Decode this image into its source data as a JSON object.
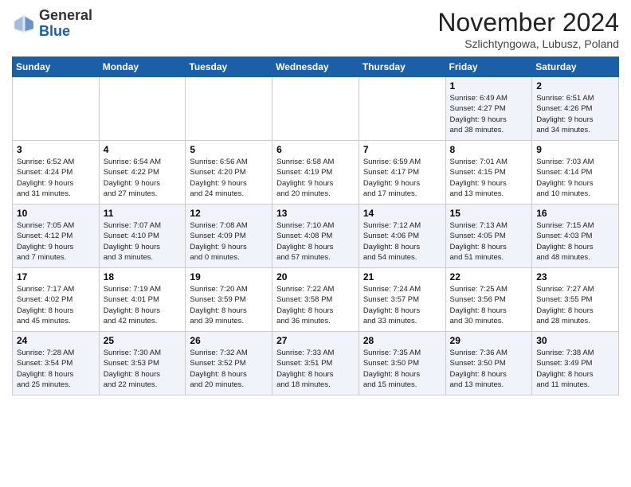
{
  "logo": {
    "general": "General",
    "blue": "Blue"
  },
  "header": {
    "month": "November 2024",
    "location": "Szlichtyngowa, Lubusz, Poland"
  },
  "days_of_week": [
    "Sunday",
    "Monday",
    "Tuesday",
    "Wednesday",
    "Thursday",
    "Friday",
    "Saturday"
  ],
  "weeks": [
    [
      {
        "day": "",
        "info": ""
      },
      {
        "day": "",
        "info": ""
      },
      {
        "day": "",
        "info": ""
      },
      {
        "day": "",
        "info": ""
      },
      {
        "day": "",
        "info": ""
      },
      {
        "day": "1",
        "info": "Sunrise: 6:49 AM\nSunset: 4:27 PM\nDaylight: 9 hours\nand 38 minutes."
      },
      {
        "day": "2",
        "info": "Sunrise: 6:51 AM\nSunset: 4:26 PM\nDaylight: 9 hours\nand 34 minutes."
      }
    ],
    [
      {
        "day": "3",
        "info": "Sunrise: 6:52 AM\nSunset: 4:24 PM\nDaylight: 9 hours\nand 31 minutes."
      },
      {
        "day": "4",
        "info": "Sunrise: 6:54 AM\nSunset: 4:22 PM\nDaylight: 9 hours\nand 27 minutes."
      },
      {
        "day": "5",
        "info": "Sunrise: 6:56 AM\nSunset: 4:20 PM\nDaylight: 9 hours\nand 24 minutes."
      },
      {
        "day": "6",
        "info": "Sunrise: 6:58 AM\nSunset: 4:19 PM\nDaylight: 9 hours\nand 20 minutes."
      },
      {
        "day": "7",
        "info": "Sunrise: 6:59 AM\nSunset: 4:17 PM\nDaylight: 9 hours\nand 17 minutes."
      },
      {
        "day": "8",
        "info": "Sunrise: 7:01 AM\nSunset: 4:15 PM\nDaylight: 9 hours\nand 13 minutes."
      },
      {
        "day": "9",
        "info": "Sunrise: 7:03 AM\nSunset: 4:14 PM\nDaylight: 9 hours\nand 10 minutes."
      }
    ],
    [
      {
        "day": "10",
        "info": "Sunrise: 7:05 AM\nSunset: 4:12 PM\nDaylight: 9 hours\nand 7 minutes."
      },
      {
        "day": "11",
        "info": "Sunrise: 7:07 AM\nSunset: 4:10 PM\nDaylight: 9 hours\nand 3 minutes."
      },
      {
        "day": "12",
        "info": "Sunrise: 7:08 AM\nSunset: 4:09 PM\nDaylight: 9 hours\nand 0 minutes."
      },
      {
        "day": "13",
        "info": "Sunrise: 7:10 AM\nSunset: 4:08 PM\nDaylight: 8 hours\nand 57 minutes."
      },
      {
        "day": "14",
        "info": "Sunrise: 7:12 AM\nSunset: 4:06 PM\nDaylight: 8 hours\nand 54 minutes."
      },
      {
        "day": "15",
        "info": "Sunrise: 7:13 AM\nSunset: 4:05 PM\nDaylight: 8 hours\nand 51 minutes."
      },
      {
        "day": "16",
        "info": "Sunrise: 7:15 AM\nSunset: 4:03 PM\nDaylight: 8 hours\nand 48 minutes."
      }
    ],
    [
      {
        "day": "17",
        "info": "Sunrise: 7:17 AM\nSunset: 4:02 PM\nDaylight: 8 hours\nand 45 minutes."
      },
      {
        "day": "18",
        "info": "Sunrise: 7:19 AM\nSunset: 4:01 PM\nDaylight: 8 hours\nand 42 minutes."
      },
      {
        "day": "19",
        "info": "Sunrise: 7:20 AM\nSunset: 3:59 PM\nDaylight: 8 hours\nand 39 minutes."
      },
      {
        "day": "20",
        "info": "Sunrise: 7:22 AM\nSunset: 3:58 PM\nDaylight: 8 hours\nand 36 minutes."
      },
      {
        "day": "21",
        "info": "Sunrise: 7:24 AM\nSunset: 3:57 PM\nDaylight: 8 hours\nand 33 minutes."
      },
      {
        "day": "22",
        "info": "Sunrise: 7:25 AM\nSunset: 3:56 PM\nDaylight: 8 hours\nand 30 minutes."
      },
      {
        "day": "23",
        "info": "Sunrise: 7:27 AM\nSunset: 3:55 PM\nDaylight: 8 hours\nand 28 minutes."
      }
    ],
    [
      {
        "day": "24",
        "info": "Sunrise: 7:28 AM\nSunset: 3:54 PM\nDaylight: 8 hours\nand 25 minutes."
      },
      {
        "day": "25",
        "info": "Sunrise: 7:30 AM\nSunset: 3:53 PM\nDaylight: 8 hours\nand 22 minutes."
      },
      {
        "day": "26",
        "info": "Sunrise: 7:32 AM\nSunset: 3:52 PM\nDaylight: 8 hours\nand 20 minutes."
      },
      {
        "day": "27",
        "info": "Sunrise: 7:33 AM\nSunset: 3:51 PM\nDaylight: 8 hours\nand 18 minutes."
      },
      {
        "day": "28",
        "info": "Sunrise: 7:35 AM\nSunset: 3:50 PM\nDaylight: 8 hours\nand 15 minutes."
      },
      {
        "day": "29",
        "info": "Sunrise: 7:36 AM\nSunset: 3:50 PM\nDaylight: 8 hours\nand 13 minutes."
      },
      {
        "day": "30",
        "info": "Sunrise: 7:38 AM\nSunset: 3:49 PM\nDaylight: 8 hours\nand 11 minutes."
      }
    ]
  ]
}
